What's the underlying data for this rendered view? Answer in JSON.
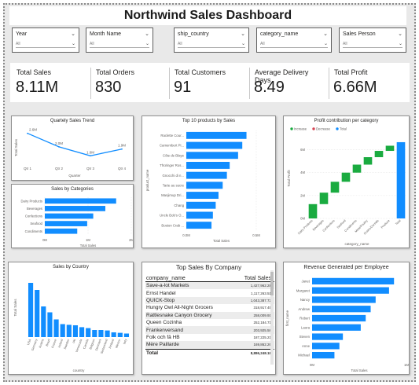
{
  "title": "Northwind Sales Dashboard",
  "slicers": [
    {
      "label": "Year",
      "value": "All"
    },
    {
      "label": "Month Name",
      "value": "All"
    },
    {
      "label": "ship_country",
      "value": "All"
    },
    {
      "label": "category_name",
      "value": "All"
    },
    {
      "label": "Sales Person",
      "value": "All"
    }
  ],
  "kpis": [
    {
      "label": "Total Sales",
      "value": "8.11M"
    },
    {
      "label": "Total Orders",
      "value": "830"
    },
    {
      "label": "Total Customers",
      "value": "91"
    },
    {
      "label": "Average Delivery Days",
      "value": "8.49"
    },
    {
      "label": "Total Profit",
      "value": "6.66M"
    }
  ],
  "table": {
    "title": "Top Sales By Company",
    "col1": "company_name",
    "col2": "Total Sales",
    "rows": [
      {
        "name": "Save-a-lot Markets",
        "value": "1,427,962.28"
      },
      {
        "name": "Ernst Handel",
        "value": "1,117,263.51"
      },
      {
        "name": "QUICK-Stop",
        "value": "1,043,387.72"
      },
      {
        "name": "Hungry Owl All-Night Grocers",
        "value": "318,917.45"
      },
      {
        "name": "Rattlesnake Canyon Grocery",
        "value": "258,009.91"
      },
      {
        "name": "Queen Cozinha",
        "value": "252,184.71"
      },
      {
        "name": "Frankenversand",
        "value": "203,925.58"
      },
      {
        "name": "Folk och fä HB",
        "value": "187,225.21"
      },
      {
        "name": "Mère Paillarde",
        "value": "169,862.26"
      }
    ],
    "total_label": "Total",
    "total_value": "8,886,248.18"
  },
  "chart_data": [
    {
      "id": "quarterly",
      "type": "line",
      "title": "Quartely Sales Trend",
      "xlabel": "Quarter",
      "ylabel": "Total Sales",
      "categories": [
        "Qtr 1",
        "Qtr 2",
        "Qtr 3",
        "Qtr 4"
      ],
      "values": [
        2.6,
        2.0,
        1.6,
        1.9
      ],
      "labels": [
        "2.6M",
        "2.0M",
        "1.6M",
        "1.9M"
      ],
      "ylim": [
        1.4,
        2.8
      ],
      "color": "#118DFF"
    },
    {
      "id": "categories",
      "type": "bar",
      "orientation": "horizontal",
      "title": "Sales by Categories",
      "xlabel": "Total Sales",
      "categories": [
        "Dairy Products",
        "Beverages",
        "Confections",
        "Seafood",
        "Condiments"
      ],
      "values": [
        1.65,
        1.4,
        1.12,
        0.98,
        0.75
      ],
      "xticks": [
        "0M",
        "1M",
        "2M"
      ],
      "xlim": [
        0,
        2
      ],
      "color": "#118DFF"
    },
    {
      "id": "top10",
      "type": "bar",
      "orientation": "horizontal",
      "title": "Top 10 products by Sales",
      "xlabel": "Total Sales",
      "ylabel": "product_name",
      "categories": [
        "Raclette Cour...",
        "Camembert Pi...",
        "Côte de Blaye",
        "Thüringer Ros...",
        "Gnocchi di n...",
        "Tarte au sucre",
        "Manjimup Dri...",
        "Chang",
        "Uncle Bob's O...",
        "Boston Crab ..."
      ],
      "values": [
        0.43,
        0.4,
        0.37,
        0.31,
        0.29,
        0.26,
        0.23,
        0.21,
        0.19,
        0.18
      ],
      "xticks": [
        "0.0M",
        "0.5M"
      ],
      "xlim": [
        0,
        0.5
      ],
      "color": "#118DFF"
    },
    {
      "id": "profit",
      "type": "waterfall",
      "title": "Profit contribution per category",
      "xlabel": "category_name",
      "ylabel": "Total Profit",
      "legend": [
        "Increase",
        "Decrease",
        "Total"
      ],
      "colors": {
        "increase": "#1AAB40",
        "decrease": "#D64554",
        "total": "#118DFF"
      },
      "categories": [
        "Dairy Products",
        "Beverages",
        "Confections",
        "Seafood",
        "Condiments",
        "Meat/Poultry",
        "Grains/Cereals",
        "Produce",
        "Total"
      ],
      "values": [
        1.25,
        1.0,
        0.95,
        0.8,
        0.7,
        0.65,
        0.55,
        0.45,
        6.66
      ],
      "yticks": [
        "0M",
        "2M",
        "4M",
        "6M"
      ],
      "ylim": [
        0,
        7
      ]
    },
    {
      "id": "country",
      "type": "bar",
      "title": "Sales by Country",
      "xlabel": "country",
      "ylabel": "Total Sales",
      "categories": [
        "USA",
        "Germany",
        "Austria",
        "Brazil",
        "France",
        "Ireland",
        "Sweden",
        "UK",
        "Venezuela",
        "Canada",
        "Belgium",
        "Denmark",
        "Switzerland",
        "Finland",
        "Mexico",
        "Italy"
      ],
      "values": [
        2.3,
        2.0,
        1.3,
        1.05,
        0.75,
        0.55,
        0.52,
        0.5,
        0.42,
        0.38,
        0.3,
        0.3,
        0.28,
        0.2,
        0.18,
        0.15
      ],
      "ylim": [
        0,
        2.5
      ],
      "color": "#118DFF"
    },
    {
      "id": "employee",
      "type": "bar",
      "orientation": "horizontal",
      "title": "Revenue Generated per Employee",
      "xlabel": "Total Sales",
      "ylabel": "first_name",
      "categories": [
        "Janet",
        "Margaret",
        "Nancy",
        "Andrew",
        "Robert",
        "Laura",
        "Steven",
        "Anne",
        "Michael"
      ],
      "values": [
        1.65,
        1.55,
        1.28,
        1.18,
        1.08,
        0.98,
        0.62,
        0.55,
        0.45
      ],
      "xticks": [
        "0M",
        "1M"
      ],
      "xlim": [
        0,
        1.9
      ],
      "color": "#118DFF"
    }
  ]
}
